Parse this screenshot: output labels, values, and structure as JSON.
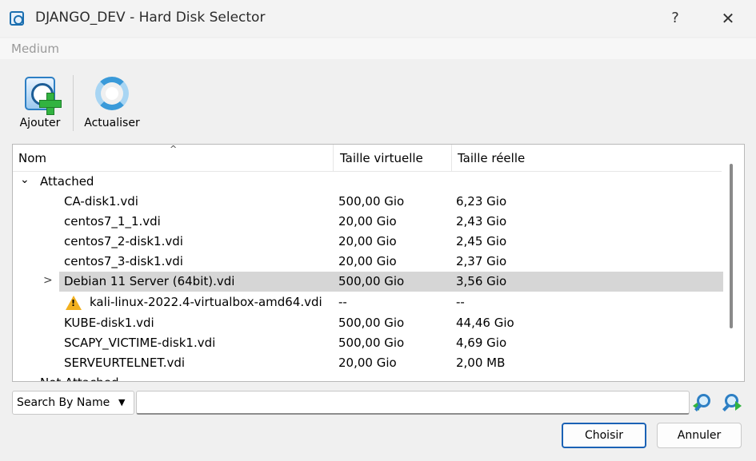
{
  "window": {
    "title": "DJANGO_DEV - Hard Disk Selector",
    "help_glyph": "?",
    "close_glyph": "✕"
  },
  "menubar": {
    "medium_label": "Medium"
  },
  "toolbar": {
    "add_label": "Ajouter",
    "refresh_label": "Actualiser"
  },
  "columns": {
    "name": "Nom",
    "virtual": "Taille virtuelle",
    "real": "Taille réelle"
  },
  "groups": {
    "attached": "Attached",
    "not_attached": "Not Attached"
  },
  "disks": [
    {
      "name": "CA-disk1.vdi",
      "virtual": "500,00 Gio",
      "real": "6,23 Gio"
    },
    {
      "name": "centos7_1_1.vdi",
      "virtual": "20,00 Gio",
      "real": "2,43 Gio"
    },
    {
      "name": "centos7_2-disk1.vdi",
      "virtual": "20,00 Gio",
      "real": "2,45 Gio"
    },
    {
      "name": "centos7_3-disk1.vdi",
      "virtual": "20,00 Gio",
      "real": "2,37 Gio"
    },
    {
      "name": "Debian 11 Server (64bit).vdi",
      "virtual": "500,00 Gio",
      "real": "3,56 Gio"
    },
    {
      "name": "kali-linux-2022.4-virtualbox-amd64.vdi",
      "virtual": "--",
      "real": "--"
    },
    {
      "name": "KUBE-disk1.vdi",
      "virtual": "500,00 Gio",
      "real": "44,46 Gio"
    },
    {
      "name": "SCAPY_VICTIME-disk1.vdi",
      "virtual": "500,00 Gio",
      "real": "4,69 Gio"
    },
    {
      "name": "SERVEURTELNET.vdi",
      "virtual": "20,00 Gio",
      "real": "2,00 MB"
    }
  ],
  "selected_disk": "Debian 11 Server (64bit).vdi",
  "search": {
    "mode": "Search By Name",
    "value": ""
  },
  "buttons": {
    "choose": "Choisir",
    "cancel": "Annuler"
  },
  "colors": {
    "accent": "#1b62b5",
    "selection": "#d6d6d6",
    "warning": "#f2b01e"
  }
}
